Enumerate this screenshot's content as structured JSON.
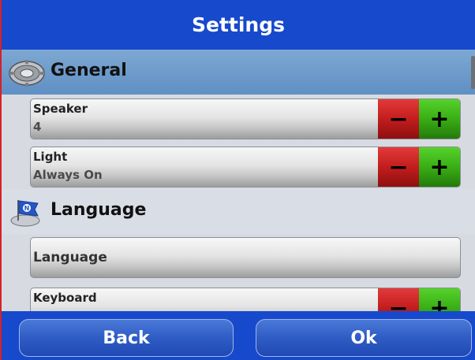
{
  "header": {
    "title": "Settings"
  },
  "sections": {
    "general": {
      "title": "General",
      "icon": "gear-icon",
      "items": [
        {
          "label": "Speaker",
          "value": "4",
          "minus": "−",
          "plus": "+"
        },
        {
          "label": "Light",
          "value": "Always On",
          "minus": "−",
          "plus": "+"
        }
      ]
    },
    "language": {
      "title": "Language",
      "icon": "flag-globe-icon",
      "items": [
        {
          "label": "Language"
        },
        {
          "label": "Keyboard",
          "minus": "−",
          "plus": "+"
        }
      ]
    }
  },
  "footer": {
    "back_label": "Back",
    "ok_label": "Ok"
  },
  "colors": {
    "bar": "#1749cc",
    "section_general": "#6f9ccc",
    "minus": "#c21d1d",
    "plus": "#3aae15",
    "left_rule": "#d3222a"
  }
}
